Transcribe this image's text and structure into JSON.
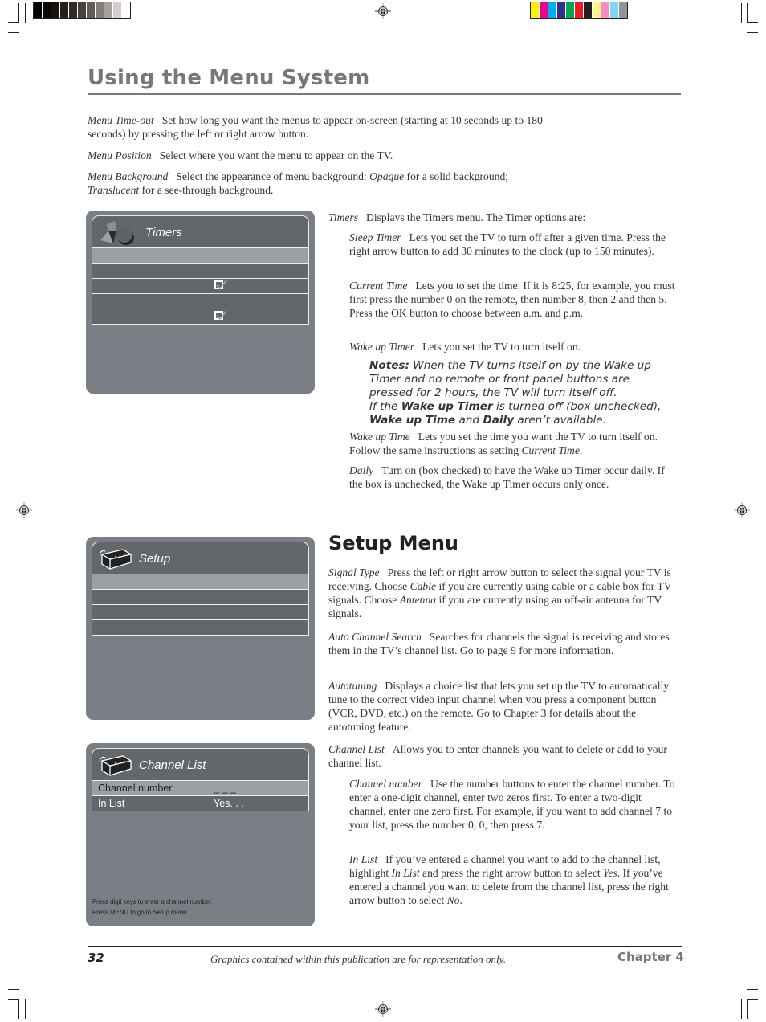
{
  "header": {
    "title": "Using the Menu System",
    "grayscale_swatches": [
      "#000000",
      "#0a0806",
      "#161210",
      "#241f1c",
      "#332b29",
      "#4a413e",
      "#655c59",
      "#857b78",
      "#a79f9c",
      "#d5cecd",
      "#ffffff"
    ],
    "color_swatches": [
      "#fff200",
      "#ec008c",
      "#00aeef",
      "#2e3192",
      "#00a651",
      "#ed1c24",
      "#231f20",
      "#fff685",
      "#f58cc6",
      "#7dd8f7",
      "#939598"
    ]
  },
  "intro": [
    {
      "term": "Menu Time-out",
      "text": "Set how long you want the menus to appear on-screen (starting at 10 seconds up to 180 seconds) by pressing the left or right arrow button."
    },
    {
      "term": "Menu Position",
      "text": "Select where you want the menu to appear on the TV."
    },
    {
      "term": "Menu Background",
      "text_a": "Select the appearance of menu background: ",
      "em_a": "Opaque",
      "text_b": " for a solid background; ",
      "em_b": "Translucent",
      "text_c": " for a see-through background."
    }
  ],
  "timers_menu": {
    "title": "Timers",
    "icon": "shapes-icon",
    "rows": [
      {
        "checked": false,
        "highlight": true
      },
      {
        "checked": false
      },
      {
        "checked": true
      },
      {
        "checked": false
      },
      {
        "checked": true
      }
    ]
  },
  "timers_text": {
    "intro_term": "Timers",
    "intro_text": "Displays the Timers menu. The Timer options are:",
    "items": [
      {
        "term": "Sleep Timer",
        "text": "Lets you set the TV to turn off after a given time. Press the right arrow button to add 30 minutes to the clock (up to 150 minutes)."
      },
      {
        "term": "Current Time",
        "text": "Lets you to set the time. If it is 8:25, for example, you must first press the number 0 on the remote, then number 8, then 2 and then 5. Press the OK button to choose between a.m. and p.m."
      },
      {
        "term": "Wake up Timer",
        "text": "Lets you set the TV to turn itself on."
      }
    ],
    "note1_label": "Notes:",
    "note1_text": " When the TV turns itself on by the Wake up Timer and no remote or front panel buttons are pressed for 2 hours, the TV will turn itself off.",
    "note2_a": "If the ",
    "note2_b": "Wake up Timer",
    "note2_c": " is turned off (box unchecked), ",
    "note2_d": "Wake up Time",
    "note2_e": " and ",
    "note2_f": "Daily",
    "note2_g": " aren’t available.",
    "wake_time_term": "Wake up Time",
    "wake_time_text": "Lets you set the time you want the TV to turn itself on. Follow the same instructions as setting ",
    "wake_time_em": "Current Time",
    "daily_term": "Daily",
    "daily_text": "Turn on (box checked) to have the Wake up Timer occur daily. If the box is unchecked, the Wake up Timer occurs only once."
  },
  "setup_menu": {
    "title": "Setup",
    "icon": "remote-box-icon",
    "rows": [
      {
        "highlight": true
      },
      {},
      {},
      {}
    ]
  },
  "setup_text": {
    "heading": "Setup Menu",
    "signal_term": "Signal Type",
    "signal_a": "Press the left or right arrow button to select the signal your TV is receiving. Choose ",
    "signal_em1": "Cable",
    "signal_b": " if you are currently using cable or a cable box for TV signals. Choose ",
    "signal_em2": "Antenna",
    "signal_c": " if you are currently using an off-air antenna for TV signals.",
    "acs_term": "Auto Channel Search",
    "acs_text": "Searches for channels the signal is receiving and stores them in the TV’s channel list. Go to page 9 for more information.",
    "auto_term": "Autotuning",
    "auto_text": "Displays a choice list that lets you set up the TV to automatically tune to the correct video input channel when you press a component button (VCR, DVD, etc.) on the remote. Go to Chapter 3 for details about the autotuning feature.",
    "cl_term": "Channel List",
    "cl_text": "Allows you to enter channels you want to delete or add to your channel list.",
    "cn_term": "Channel number",
    "cn_text": "Use the number buttons to enter the channel number. To enter a one-digit channel, enter two zeros first. To enter a two-digit channel, enter one zero first. For example, if you want to add channel 7 to your list, press the number 0, 0, then press 7.",
    "il_term": "In List",
    "il_a": "If you’ve entered a channel you want to add to the channel list, highlight ",
    "il_em1": "In List",
    "il_b": " and press the right arrow button to select ",
    "il_em2": "Yes",
    "il_c": ". If you’ve entered a channel you want to delete from the channel list, press the right arrow button to select ",
    "il_em3": "No",
    "il_d": "."
  },
  "channel_list_menu": {
    "title": "Channel List",
    "icon": "remote-box-icon",
    "rows": [
      {
        "label": "Channel number",
        "value": "_ _ _",
        "highlight": true
      },
      {
        "label": "In List",
        "value": "Yes. . ."
      }
    ],
    "hint1": "Press digit keys to enter a channel number.",
    "hint2": "Press MENU to go to Setup menu."
  },
  "footer": {
    "page_number": "32",
    "note": "Graphics contained within this publication are for representation only.",
    "chapter": "Chapter 4"
  }
}
